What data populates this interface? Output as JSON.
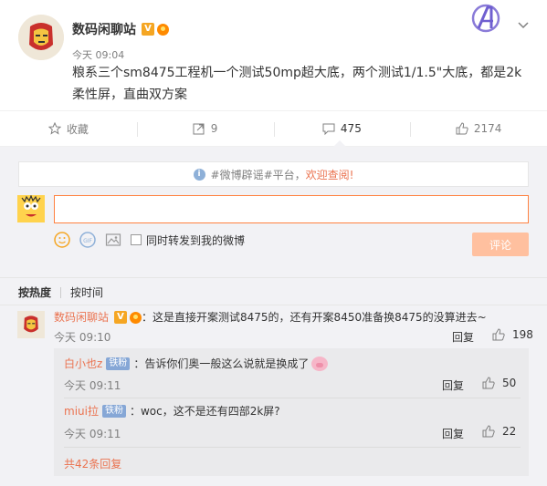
{
  "post": {
    "username": "数码闲聊站",
    "verified_badge": "V",
    "time": "今天 09:04",
    "text": "粮系三个sm8475工程机一个测试50mp超大底，两个测试1/1.5\"大底，都是2k柔性屏，直曲双方案",
    "more_icon": "chevron-down-icon"
  },
  "actions": {
    "favorite_label": "收藏",
    "repost_count": "9",
    "comment_count": "475",
    "like_count": "2174"
  },
  "notice": {
    "prefix": "#微博辟谣#平台，",
    "link": "欢迎查阅!"
  },
  "composer": {
    "input_value": "",
    "forward_label": "同时转发到我的微博",
    "submit_label": "评论"
  },
  "sort": {
    "hot": "按热度",
    "time": "按时间"
  },
  "comments": [
    {
      "user": "数码闲聊站",
      "verified_badge": "V",
      "text": "：这是直接开案测试8475的，还有开案8450准备换8475的没算进去~",
      "time": "今天 09:10",
      "reply": "回复",
      "likes": "198"
    }
  ],
  "replies": [
    {
      "user": "白小也z",
      "fan_badge": "铁粉",
      "text": "：告诉你们奥一般这么说就是换成了",
      "time": "今天 09:11",
      "reply": "回复",
      "likes": "50"
    },
    {
      "user": "miui拉",
      "fan_badge": "铁粉",
      "text": "：woc，这不是还有四部2k屏?",
      "time": "今天 09:11",
      "reply": "回复",
      "likes": "22"
    }
  ],
  "more_replies": "共42条回复",
  "colors": {
    "accent": "#eb7350",
    "badge_orange": "#f5a623",
    "fan_badge": "#86a7d6",
    "submit_disabled": "#ffc09f",
    "input_border": "#ff8140"
  }
}
